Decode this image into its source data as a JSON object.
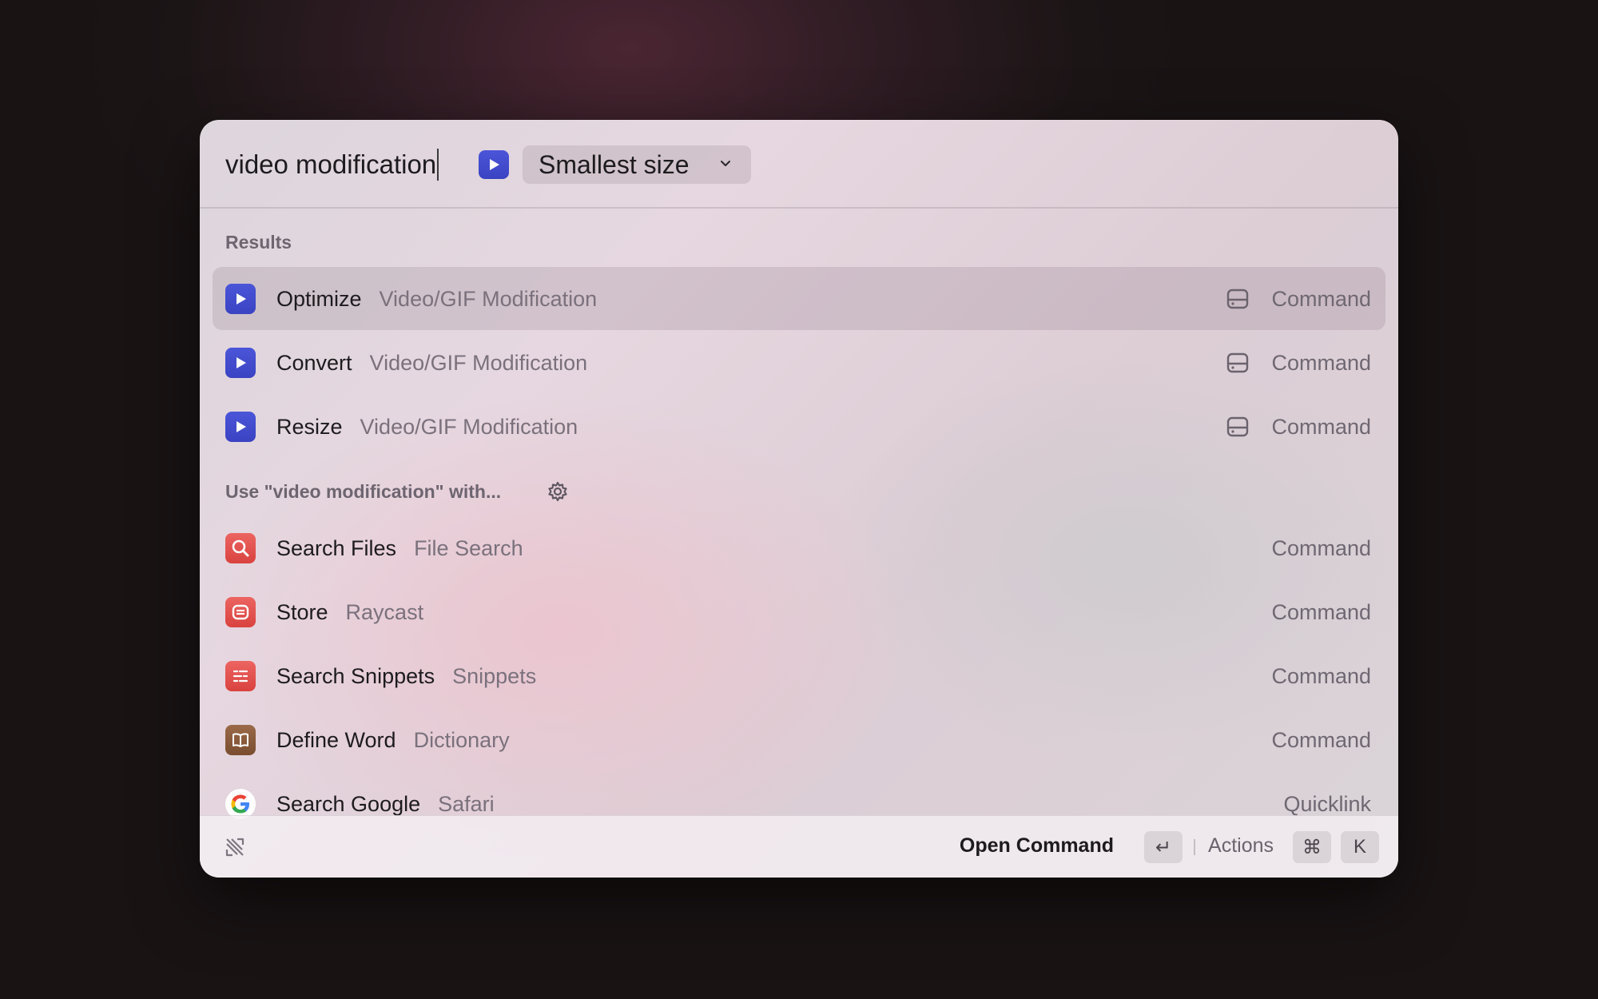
{
  "search": {
    "query": "video modification"
  },
  "extension": {
    "icon": "play-icon",
    "color": "#4049d1"
  },
  "dropdown": {
    "selected": "Smallest size",
    "icon": "chevron-down-icon"
  },
  "sections": {
    "results": "Results",
    "fallback": "Use \"video modification\" with..."
  },
  "results": [
    {
      "title": "Optimize",
      "subtitle": "Video/GIF Modification",
      "type": "Command",
      "icon": "play-icon",
      "accessory": "drive-icon",
      "selected": true
    },
    {
      "title": "Convert",
      "subtitle": "Video/GIF Modification",
      "type": "Command",
      "icon": "play-icon",
      "accessory": "drive-icon"
    },
    {
      "title": "Resize",
      "subtitle": "Video/GIF Modification",
      "type": "Command",
      "icon": "play-icon",
      "accessory": "drive-icon"
    }
  ],
  "fallbacks": [
    {
      "title": "Search Files",
      "subtitle": "File Search",
      "type": "Command",
      "icon": "magnifier-icon",
      "color": "#e0514f"
    },
    {
      "title": "Store",
      "subtitle": "Raycast",
      "type": "Command",
      "icon": "store-icon",
      "color": "#e0514f"
    },
    {
      "title": "Search Snippets",
      "subtitle": "Snippets",
      "type": "Command",
      "icon": "snippets-icon",
      "color": "#e0514f"
    },
    {
      "title": "Define Word",
      "subtitle": "Dictionary",
      "type": "Command",
      "icon": "book-icon",
      "color": "#8a5a3c"
    },
    {
      "title": "Search Google",
      "subtitle": "Safari",
      "type": "Quicklink",
      "icon": "google-icon",
      "color": "#ffffff"
    }
  ],
  "footer": {
    "primary_action": "Open Command",
    "primary_key": "↵",
    "actions_label": "Actions",
    "actions_keys": [
      "⌘",
      "K"
    ]
  }
}
